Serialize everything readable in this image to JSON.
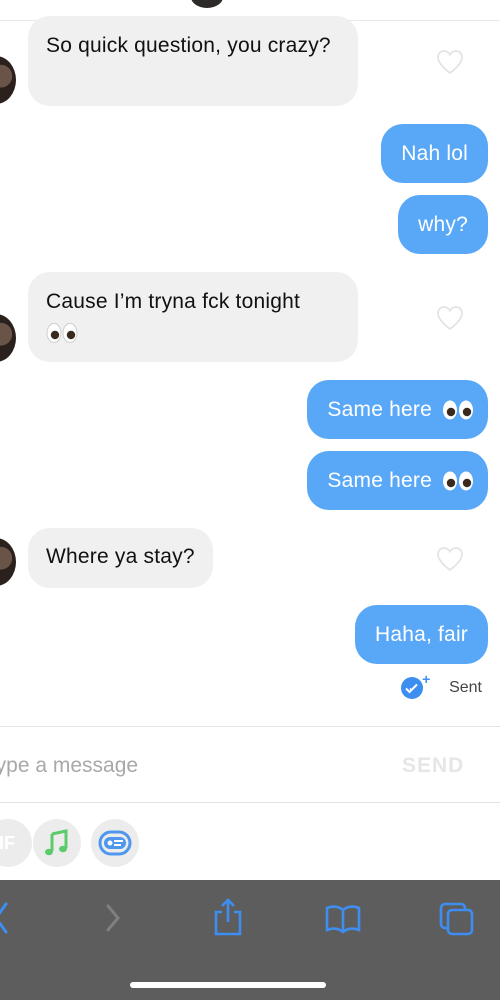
{
  "colors": {
    "outgoing_bubble": "#59a8f8",
    "incoming_bubble": "#f0f0f0",
    "sent_badge": "#3c8ff0",
    "toolbar": "#5d5d5d",
    "toolbar_icon": "#3d8ef0"
  },
  "messages": [
    {
      "side": "incoming",
      "text": "So quick question, you crazy?",
      "emoji": ""
    },
    {
      "side": "outgoing",
      "text": "Nah lol",
      "emoji": ""
    },
    {
      "side": "outgoing",
      "text": "why?",
      "emoji": ""
    },
    {
      "side": "incoming",
      "text": "Cause I’m tryna fck tonight",
      "emoji": "👀"
    },
    {
      "side": "outgoing",
      "text": "Same here",
      "emoji": "👀"
    },
    {
      "side": "outgoing",
      "text": "Same here",
      "emoji": "👀"
    },
    {
      "side": "incoming",
      "text": "Where ya stay?",
      "emoji": ""
    },
    {
      "side": "outgoing",
      "text": "Haha, fair",
      "emoji": ""
    }
  ],
  "status": {
    "label": "Sent"
  },
  "composer": {
    "placeholder": "Type a message",
    "send_label": "SEND"
  },
  "attachments": [
    {
      "icon": "gif-icon",
      "label": "GIF"
    },
    {
      "icon": "music-note-icon"
    },
    {
      "icon": "sticker-card-icon"
    }
  ],
  "browser_toolbar": {
    "icons": [
      "back-icon",
      "forward-icon",
      "share-icon",
      "bookmarks-icon",
      "tabs-icon"
    ]
  }
}
